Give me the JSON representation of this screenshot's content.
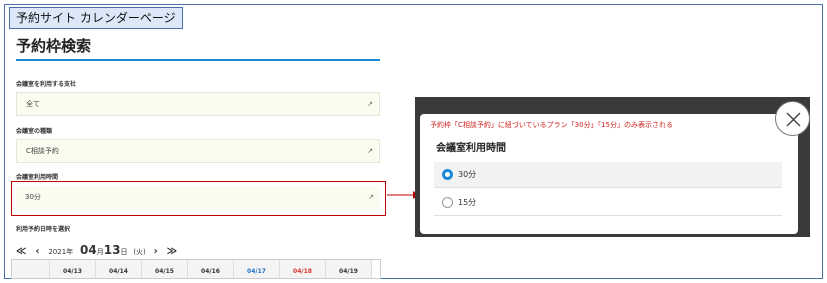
{
  "caption": "予約サイト カレンダーページ",
  "page": {
    "title": "予約枠検索",
    "fields": [
      {
        "label": "会議室を利用する支社",
        "value": "全て"
      },
      {
        "label": "会議室の種類",
        "value": "C相談予約"
      },
      {
        "label": "会議室利用時間",
        "value": "30分"
      }
    ],
    "select_arrow": "↗",
    "date_section_label": "利用予約日時を選択",
    "date_nav": {
      "first": "≪",
      "prev": "‹",
      "year": "2021年",
      "month": "04",
      "month_unit": "月",
      "day": "13",
      "day_unit": "日",
      "weekday": "(火)",
      "next": "›",
      "last": "≫"
    },
    "calendar_days": [
      "04/13",
      "04/14",
      "04/15",
      "04/16",
      "04/17",
      "04/18",
      "04/19"
    ]
  },
  "modal": {
    "annotation": "予約枠「C相談予約」に紐づいているプラン「30分」「15分」のみ表示される",
    "title": "会議室利用時間",
    "options": [
      {
        "label": "30分",
        "selected": true
      },
      {
        "label": "15分",
        "selected": false
      }
    ]
  },
  "colors": {
    "accent": "#1e88d8",
    "highlight": "#c00000",
    "annotation": "#d11f1f",
    "saturday": "#1e6fc2",
    "sunday": "#d9332a"
  },
  "icons": {
    "close": "close-icon",
    "radio": "radio-icon",
    "arrow": "arrow-right-icon"
  }
}
